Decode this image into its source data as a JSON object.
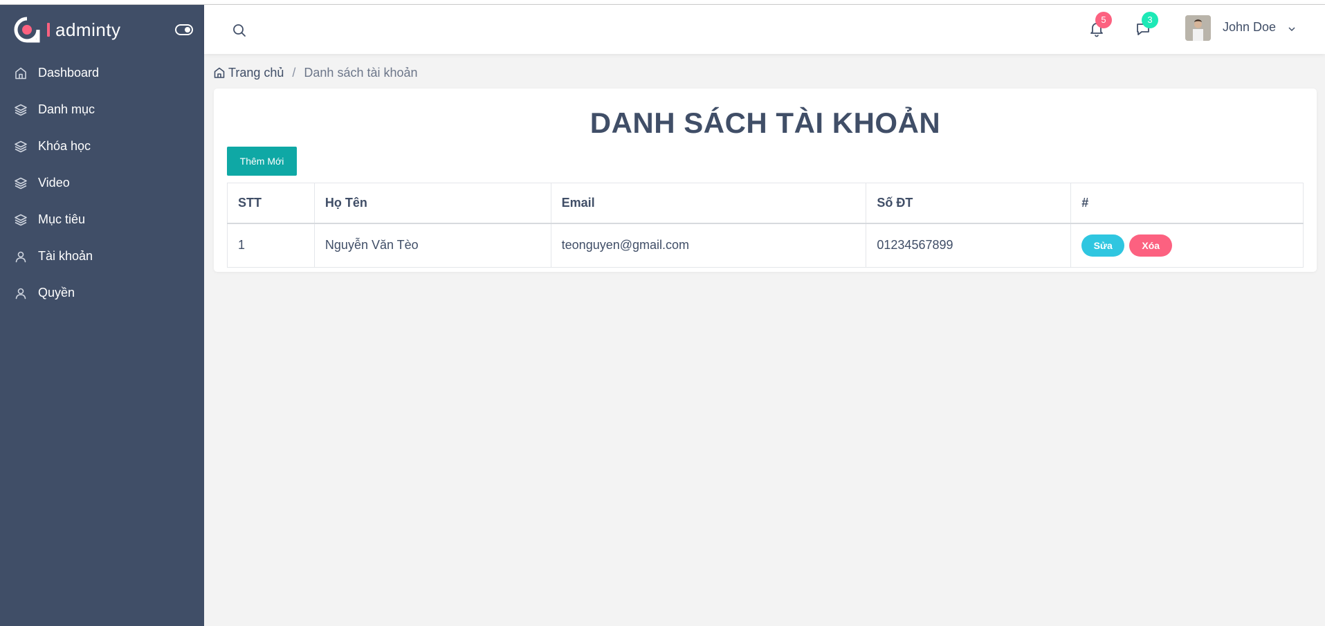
{
  "app": {
    "brand": "adminty",
    "colors": {
      "sidebar": "#404e67",
      "accent_red": "#fc6180",
      "accent_green": "#1de9b6",
      "button_teal": "#0fa8a5",
      "button_cyan": "#2fc6e0"
    }
  },
  "sidebar": {
    "items": [
      {
        "label": "Dashboard",
        "icon": "home-icon"
      },
      {
        "label": "Danh mục",
        "icon": "layers-icon"
      },
      {
        "label": "Khóa học",
        "icon": "layers-icon"
      },
      {
        "label": "Video",
        "icon": "layers-icon"
      },
      {
        "label": "Mục tiêu",
        "icon": "layers-icon"
      },
      {
        "label": "Tài khoản",
        "icon": "user-icon"
      },
      {
        "label": "Quyền",
        "icon": "user-icon"
      }
    ]
  },
  "header": {
    "notifications_count": "5",
    "messages_count": "3",
    "user_name": "John Doe"
  },
  "breadcrumb": {
    "home": "Trang chủ",
    "separator": "/",
    "current": "Danh sách tài khoản"
  },
  "main": {
    "title": "DANH SÁCH TÀI KHOẢN",
    "add_button": "Thêm Mới",
    "table": {
      "headers": [
        "STT",
        "Họ Tên",
        "Email",
        "Số ĐT",
        "#"
      ],
      "rows": [
        {
          "stt": "1",
          "name": "Nguyễn Văn Tèo",
          "email": "teonguyen@gmail.com",
          "phone": "01234567899",
          "edit": "Sửa",
          "delete": "Xóa"
        }
      ]
    }
  }
}
